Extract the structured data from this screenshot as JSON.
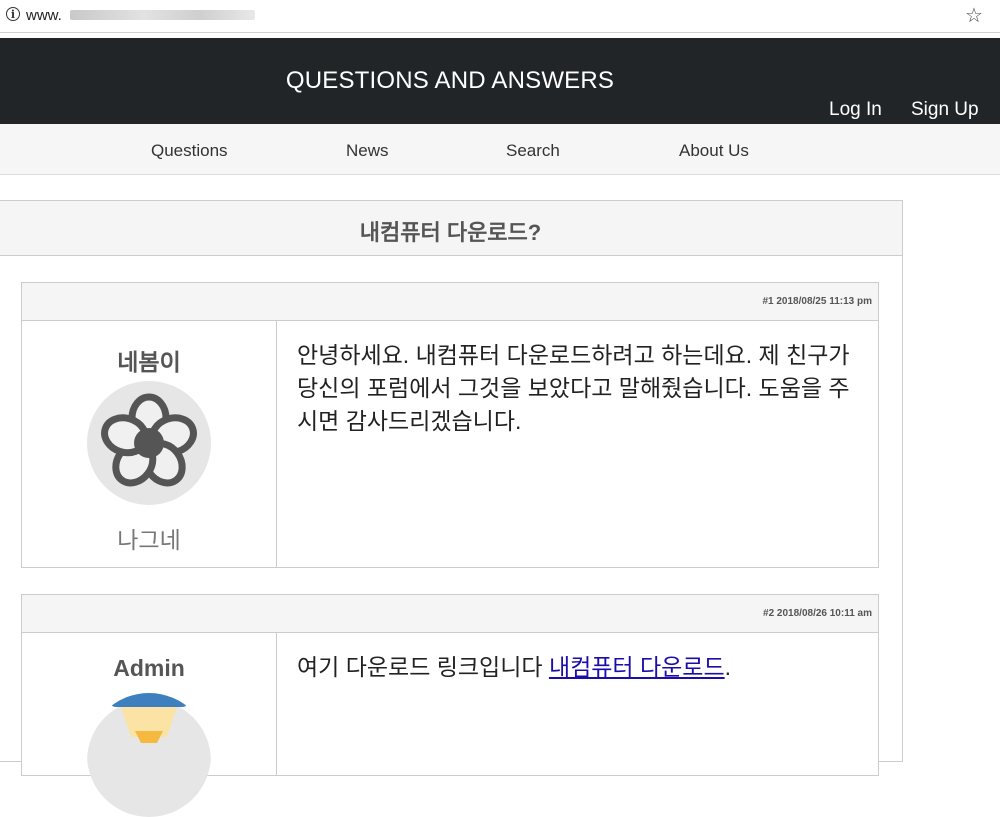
{
  "browser": {
    "url_prefix": "www.",
    "icons": {
      "info": "info-icon",
      "bookmark": "star-icon"
    }
  },
  "header": {
    "title": "QUESTIONS AND ANSWERS",
    "login": "Log In",
    "signup": "Sign Up"
  },
  "nav": {
    "items": [
      {
        "label": "Questions"
      },
      {
        "label": "News"
      },
      {
        "label": "Search"
      },
      {
        "label": "About Us"
      }
    ]
  },
  "topic": {
    "title": "내컴퓨터 다운로드?",
    "posts": [
      {
        "meta": "#1 2018/08/25 11:13 pm",
        "author": "네봄이",
        "rank": "나그네",
        "avatar_icon": "flower-avatar-icon",
        "body": "안녕하세요. 내컴퓨터 다운로드하려고 하는데요. 제 친구가 당신의 포럼에서 그것을 보았다고 말해줬습니다. 도움을 주시면 감사드리겠습니다."
      },
      {
        "meta": "#2 2018/08/26 10:11 am",
        "author": "Admin",
        "avatar_icon": "admin-avatar-icon",
        "body_prefix": "여기 다운로드 링크입니다 ",
        "link_text": "내컴퓨터 다운로드",
        "body_suffix": "."
      }
    ]
  },
  "colors": {
    "header_bg": "#212528",
    "nav_bg": "#f6f6f6",
    "panel_header_bg": "#f5f5f5",
    "link": "#1a0dab"
  }
}
